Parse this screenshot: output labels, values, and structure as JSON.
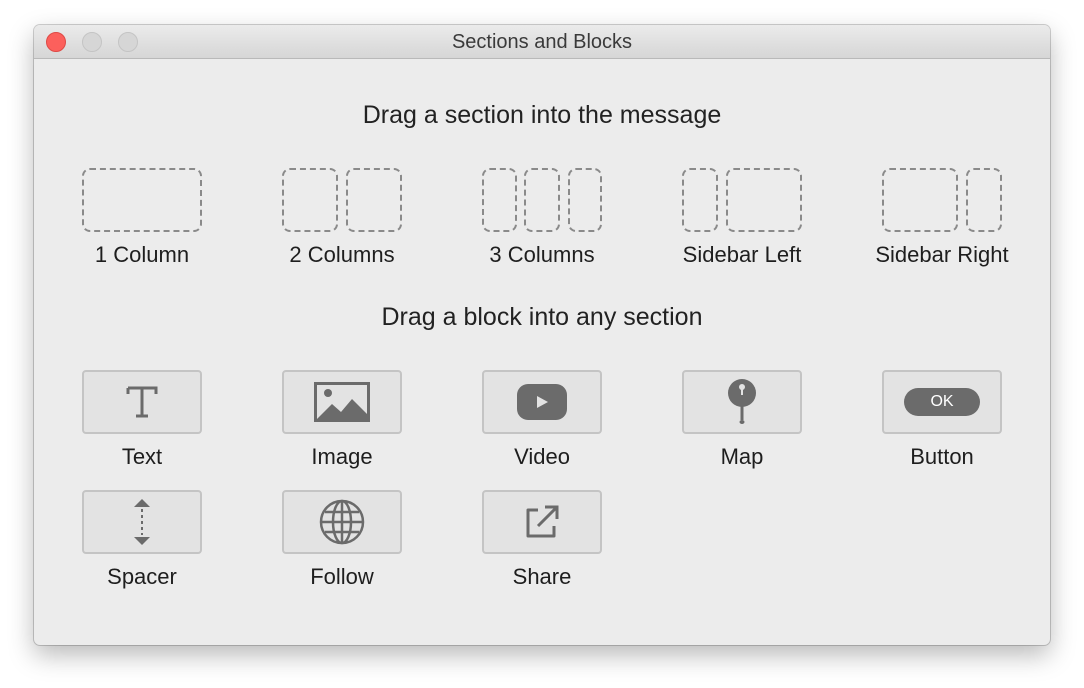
{
  "window": {
    "title": "Sections and Blocks"
  },
  "sections": {
    "heading": "Drag a section into the message",
    "items": [
      {
        "label": "1 Column",
        "icon": "one-column-layout-icon"
      },
      {
        "label": "2 Columns",
        "icon": "two-columns-layout-icon"
      },
      {
        "label": "3 Columns",
        "icon": "three-columns-layout-icon"
      },
      {
        "label": "Sidebar Left",
        "icon": "sidebar-left-layout-icon"
      },
      {
        "label": "Sidebar Right",
        "icon": "sidebar-right-layout-icon"
      }
    ]
  },
  "blocks": {
    "heading": "Drag a block into any section",
    "items": [
      {
        "label": "Text",
        "icon": "text-icon"
      },
      {
        "label": "Image",
        "icon": "image-icon"
      },
      {
        "label": "Video",
        "icon": "video-icon"
      },
      {
        "label": "Map",
        "icon": "map-pin-icon"
      },
      {
        "label": "Button",
        "icon": "button-icon",
        "pill_text": "OK"
      },
      {
        "label": "Spacer",
        "icon": "spacer-icon"
      },
      {
        "label": "Follow",
        "icon": "globe-icon"
      },
      {
        "label": "Share",
        "icon": "share-icon"
      }
    ]
  },
  "colors": {
    "window_background": "#ececec",
    "close_button": "#fc605c",
    "icon_gray": "#6b6b6b"
  }
}
